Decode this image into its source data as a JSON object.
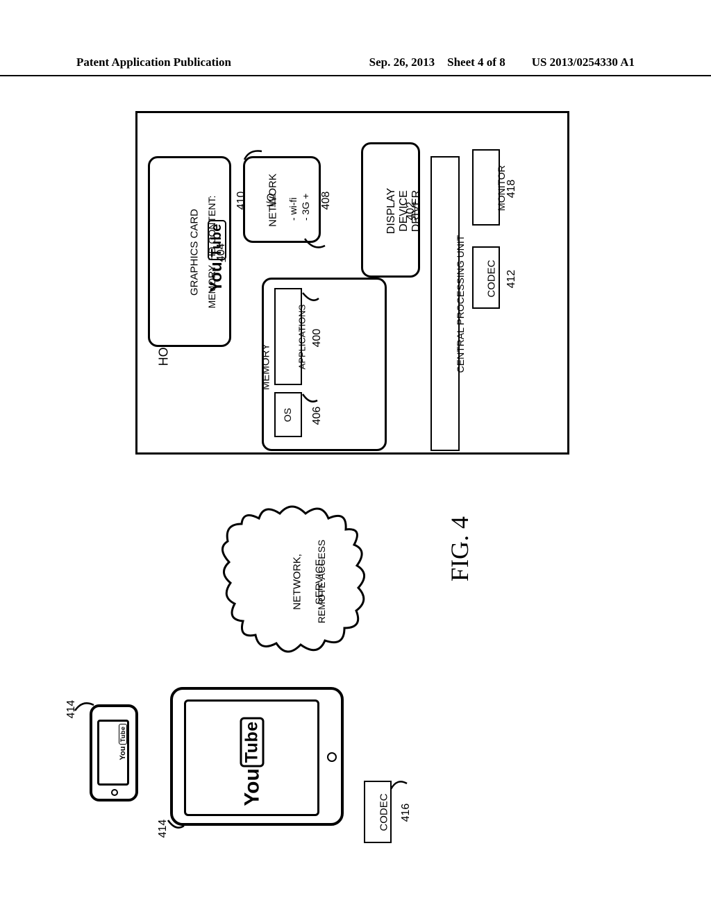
{
  "header": {
    "pub": "Patent Application Publication",
    "date": "Sep. 26, 2013",
    "sheet": "Sheet 4 of 8",
    "docnum": "US 2013/0254330 A1"
  },
  "figure_label": "FIG. 4",
  "host": {
    "title": "HOST COMPUTING ENTITY",
    "graphics": {
      "line1": "GRAPHICS CARD",
      "line2": "MEMORY, HD CONTENT:",
      "brand_you": "You",
      "brand_tube": "Tube",
      "ref": "404"
    },
    "netio": {
      "title": "NETWORK",
      "sub": "I/O",
      "opt_wifi": "- wi-fi",
      "opt_3g": "- 3G +",
      "ref_top": "410",
      "ref_bottom": "408"
    },
    "ddd": {
      "line1": "DISPLAY",
      "line2": "DEVICE",
      "line3": "DRIVER",
      "ref": "402"
    },
    "memory": {
      "label": "MEMORY",
      "os": "OS",
      "os_ref": "406",
      "apps": "APPLICATIONS",
      "apps_ref": "400"
    },
    "cpu": "CENTRAL PROCESSING UNIT",
    "codec": {
      "label": "CODEC",
      "ref": "412"
    },
    "monitor": {
      "label": "MONITOR",
      "ref": "418"
    }
  },
  "cloud": {
    "line1": "NETWORK,",
    "line2": "REMOTE ACCESS",
    "line3": "SERVICE"
  },
  "phone": {
    "ref": "414",
    "brand_you": "You",
    "brand_tube": "Tube"
  },
  "tablet": {
    "ref": "414",
    "brand_you": "You",
    "brand_tube": "Tube"
  },
  "codec_client": {
    "label": "CODEC",
    "ref": "416"
  }
}
